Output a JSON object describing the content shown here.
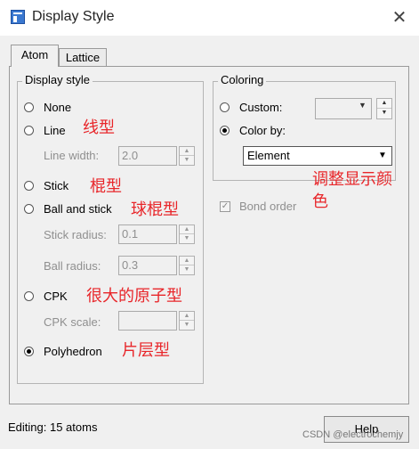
{
  "window": {
    "title": "Display Style",
    "close_glyph": "✕"
  },
  "tabs": [
    {
      "label": "Atom"
    },
    {
      "label": "Lattice"
    }
  ],
  "display_style": {
    "legend": "Display style",
    "options": {
      "none": "None",
      "line": "Line",
      "stick": "Stick",
      "ball_and_stick": "Ball and stick",
      "cpk": "CPK",
      "polyhedron": "Polyhedron"
    },
    "selected": "Polyhedron",
    "line_width": {
      "label": "Line width:",
      "value": "2.0"
    },
    "stick_radius": {
      "label": "Stick radius:",
      "value": "0.1"
    },
    "ball_radius": {
      "label": "Ball radius:",
      "value": "0.3"
    },
    "cpk_scale": {
      "label": "CPK scale:",
      "value": ""
    }
  },
  "coloring": {
    "legend": "Coloring",
    "custom_label": "Custom:",
    "color_by_label": "Color by:",
    "selected": "Color by:",
    "color_by_value": "Element"
  },
  "bond_order": {
    "label": "Bond order",
    "checked": true
  },
  "annotations": {
    "line": "线型",
    "stick": "棍型",
    "ball_and_stick": "球棍型",
    "cpk": "很大的原子型",
    "polyhedron": "片层型",
    "coloring_line1": "调整显示颜",
    "coloring_line2": "色"
  },
  "status": {
    "text": "Editing: 15 atoms"
  },
  "help_button": {
    "label": "Help"
  },
  "watermark": "CSDN @electrochemjy",
  "colors": {
    "annotation": "#e8262a",
    "title_icon": "#3a78d0"
  }
}
